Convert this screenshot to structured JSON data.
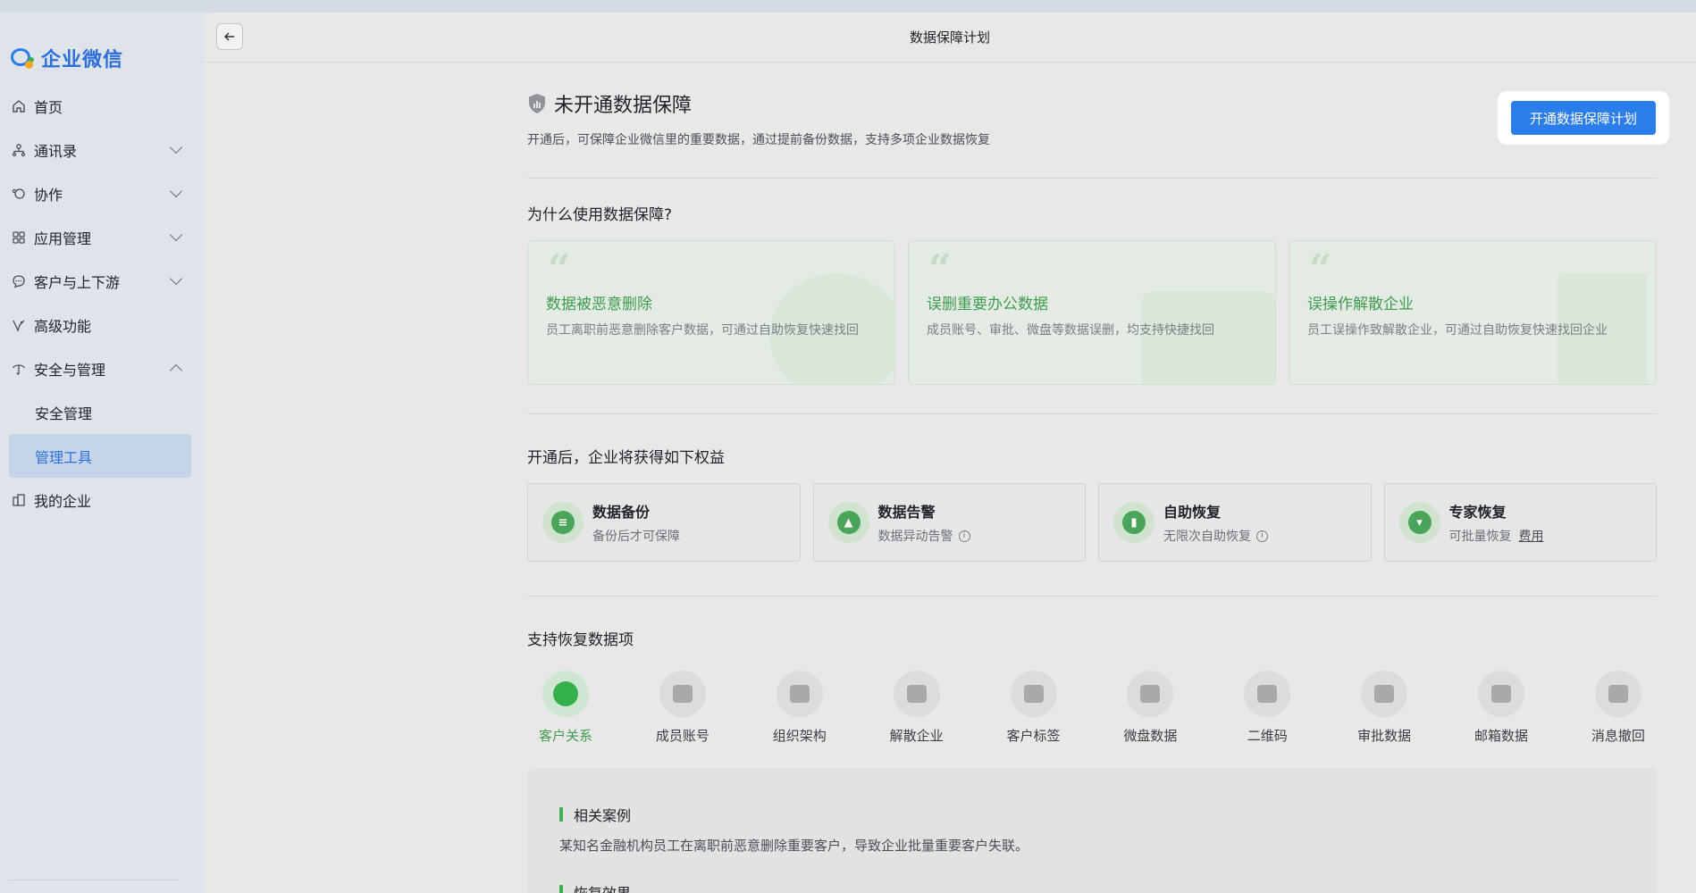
{
  "app": {
    "name": "企业微信"
  },
  "sidebar": {
    "items": [
      {
        "label": "首页",
        "icon": "home-icon",
        "expandable": false
      },
      {
        "label": "通讯录",
        "icon": "contacts-icon",
        "expandable": true
      },
      {
        "label": "协作",
        "icon": "collab-icon",
        "expandable": true
      },
      {
        "label": "应用管理",
        "icon": "apps-icon",
        "expandable": true
      },
      {
        "label": "客户与上下游",
        "icon": "chat-icon",
        "expandable": true
      },
      {
        "label": "高级功能",
        "icon": "advanced-icon",
        "expandable": false
      },
      {
        "label": "安全与管理",
        "icon": "security-icon",
        "expandable": true,
        "expanded": true
      },
      {
        "label": "我的企业",
        "icon": "company-icon",
        "expandable": false
      }
    ],
    "sub_items": [
      {
        "label": "安全管理",
        "active": false
      },
      {
        "label": "管理工具",
        "active": true
      }
    ]
  },
  "header": {
    "title": "数据保障计划"
  },
  "status": {
    "title": "未开通数据保障",
    "description": "开通后，可保障企业微信里的重要数据，通过提前备份数据，支持多项企业数据恢复",
    "cta_label": "开通数据保障计划"
  },
  "why": {
    "title": "为什么使用数据保障?",
    "cards": [
      {
        "title": "数据被恶意删除",
        "desc": "员工离职前恶意删除客户数据，可通过自助恢复快速找回"
      },
      {
        "title": "误删重要办公数据",
        "desc": "成员账号、审批、微盘等数据误删，均支持快捷找回"
      },
      {
        "title": "误操作解散企业",
        "desc": "员工误操作致解散企业，可通过自助恢复快速找回企业"
      }
    ]
  },
  "benefits": {
    "title": "开通后，企业将获得如下权益",
    "cards": [
      {
        "title": "数据备份",
        "sub": "备份后才可保障",
        "info": false
      },
      {
        "title": "数据告警",
        "sub": "数据异动告警",
        "info": true
      },
      {
        "title": "自助恢复",
        "sub": "无限次自助恢复",
        "info": true
      },
      {
        "title": "专家恢复",
        "sub": "可批量恢复",
        "link": "费用"
      }
    ]
  },
  "recover": {
    "title": "支持恢复数据项",
    "items": [
      {
        "label": "客户关系",
        "icon": "wechat-chat-icon",
        "active": true
      },
      {
        "label": "成员账号",
        "icon": "members-icon"
      },
      {
        "label": "组织架构",
        "icon": "org-chart-icon"
      },
      {
        "label": "解散企业",
        "icon": "building-icon"
      },
      {
        "label": "客户标签",
        "icon": "tag-icon"
      },
      {
        "label": "微盘数据",
        "icon": "drive-icon"
      },
      {
        "label": "二维码",
        "icon": "qrcode-icon"
      },
      {
        "label": "审批数据",
        "icon": "stamp-icon"
      },
      {
        "label": "邮箱数据",
        "icon": "mail-icon"
      },
      {
        "label": "消息撤回",
        "icon": "recall-icon"
      }
    ],
    "case_title": "相关案例",
    "case_text": "某知名金融机构员工在离职前恶意删除重要客户，导致企业批量重要客户失联。",
    "effect_title": "恢复效果"
  },
  "colors": {
    "accent": "#2b7de9",
    "green": "#3f9b4d"
  }
}
